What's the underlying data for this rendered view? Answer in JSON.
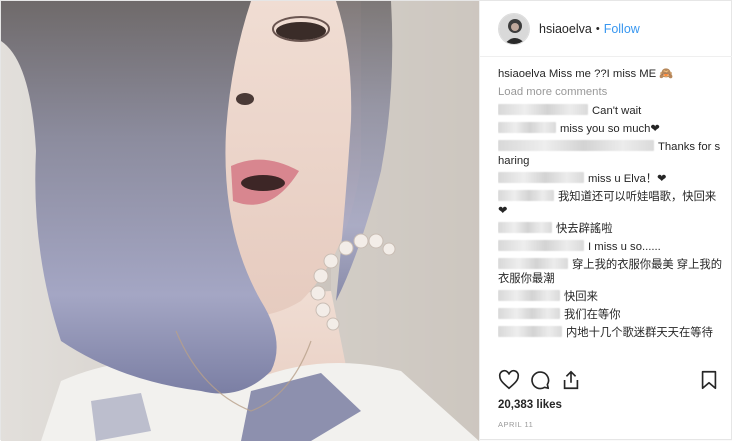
{
  "post": {
    "username": "hsiaoelva",
    "separator": "•",
    "follow_label": "Follow",
    "caption_user": "hsiaoelva",
    "caption_text": "Miss me ??I miss ME",
    "caption_emoji": "🙈",
    "load_more": "Load more comments",
    "likes": "20,383 likes",
    "date": "APRIL 11"
  },
  "comments": [
    {
      "text": "Can't wait"
    },
    {
      "text": "miss you so much❤"
    },
    {
      "text": "Thanks for sharing"
    },
    {
      "text": "miss u Elva！❤"
    },
    {
      "text": "我知道还可以听娃唱歌，快回来❤"
    },
    {
      "text": "快去辟謠啦"
    },
    {
      "text": "I miss u so......"
    },
    {
      "text": "穿上我的衣服你最美 穿上我的衣服你最潮"
    },
    {
      "text": "快回来"
    },
    {
      "text": "我们在等你"
    },
    {
      "text": "内地十几个歌迷群天天在等待"
    }
  ],
  "icons": {
    "like": "heart-icon",
    "comment": "comment-icon",
    "share": "share-icon",
    "save": "bookmark-icon"
  },
  "colors": {
    "follow": "#3897f0",
    "hair": "#8d8ea8",
    "skin": "#ecd6cc"
  }
}
